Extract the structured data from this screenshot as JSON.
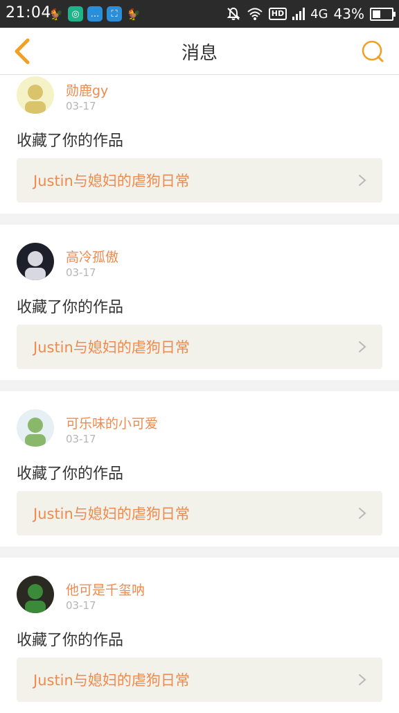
{
  "status_bar": {
    "time": "21:04",
    "apps": [
      {
        "icon": "rooster-icon",
        "color": "transparent",
        "glyph": "🐓"
      },
      {
        "icon": "app-circle-icon",
        "color": "#1fb38a",
        "glyph": "◎"
      },
      {
        "icon": "chat-bubble-icon",
        "color": "#2b8ed9",
        "glyph": "…"
      },
      {
        "icon": "scan-icon",
        "color": "#2b8ed9",
        "glyph": "⛶"
      },
      {
        "icon": "rooster-icon",
        "color": "transparent",
        "glyph": "🐓"
      }
    ],
    "hd": "HD",
    "network": "4G",
    "battery_text": "43%",
    "battery_level": 0.43
  },
  "nav": {
    "title": "消息",
    "accent": "#f0a024"
  },
  "messages": [
    {
      "username": "勋鹿gy",
      "date": "03-17",
      "action": "收藏了你的作品",
      "work_title": "Justin与媳妇的虐狗日常",
      "avatar_colors": [
        "#f6f2c8",
        "#d9c46b"
      ]
    },
    {
      "username": "高冷孤傲",
      "date": "03-17",
      "action": "收藏了你的作品",
      "work_title": "Justin与媳妇的虐狗日常",
      "avatar_colors": [
        "#1d1f2a",
        "#d8d8e0"
      ]
    },
    {
      "username": "可乐味的小可爱",
      "date": "03-17",
      "action": "收藏了你的作品",
      "work_title": "Justin与媳妇的虐狗日常",
      "avatar_colors": [
        "#e6f0f4",
        "#8ab86a"
      ]
    },
    {
      "username": "他可是千玺呐",
      "date": "03-17",
      "action": "收藏了你的作品",
      "work_title": "Justin与媳妇的虐狗日常",
      "avatar_colors": [
        "#2a2a22",
        "#3a8a3a"
      ]
    }
  ]
}
